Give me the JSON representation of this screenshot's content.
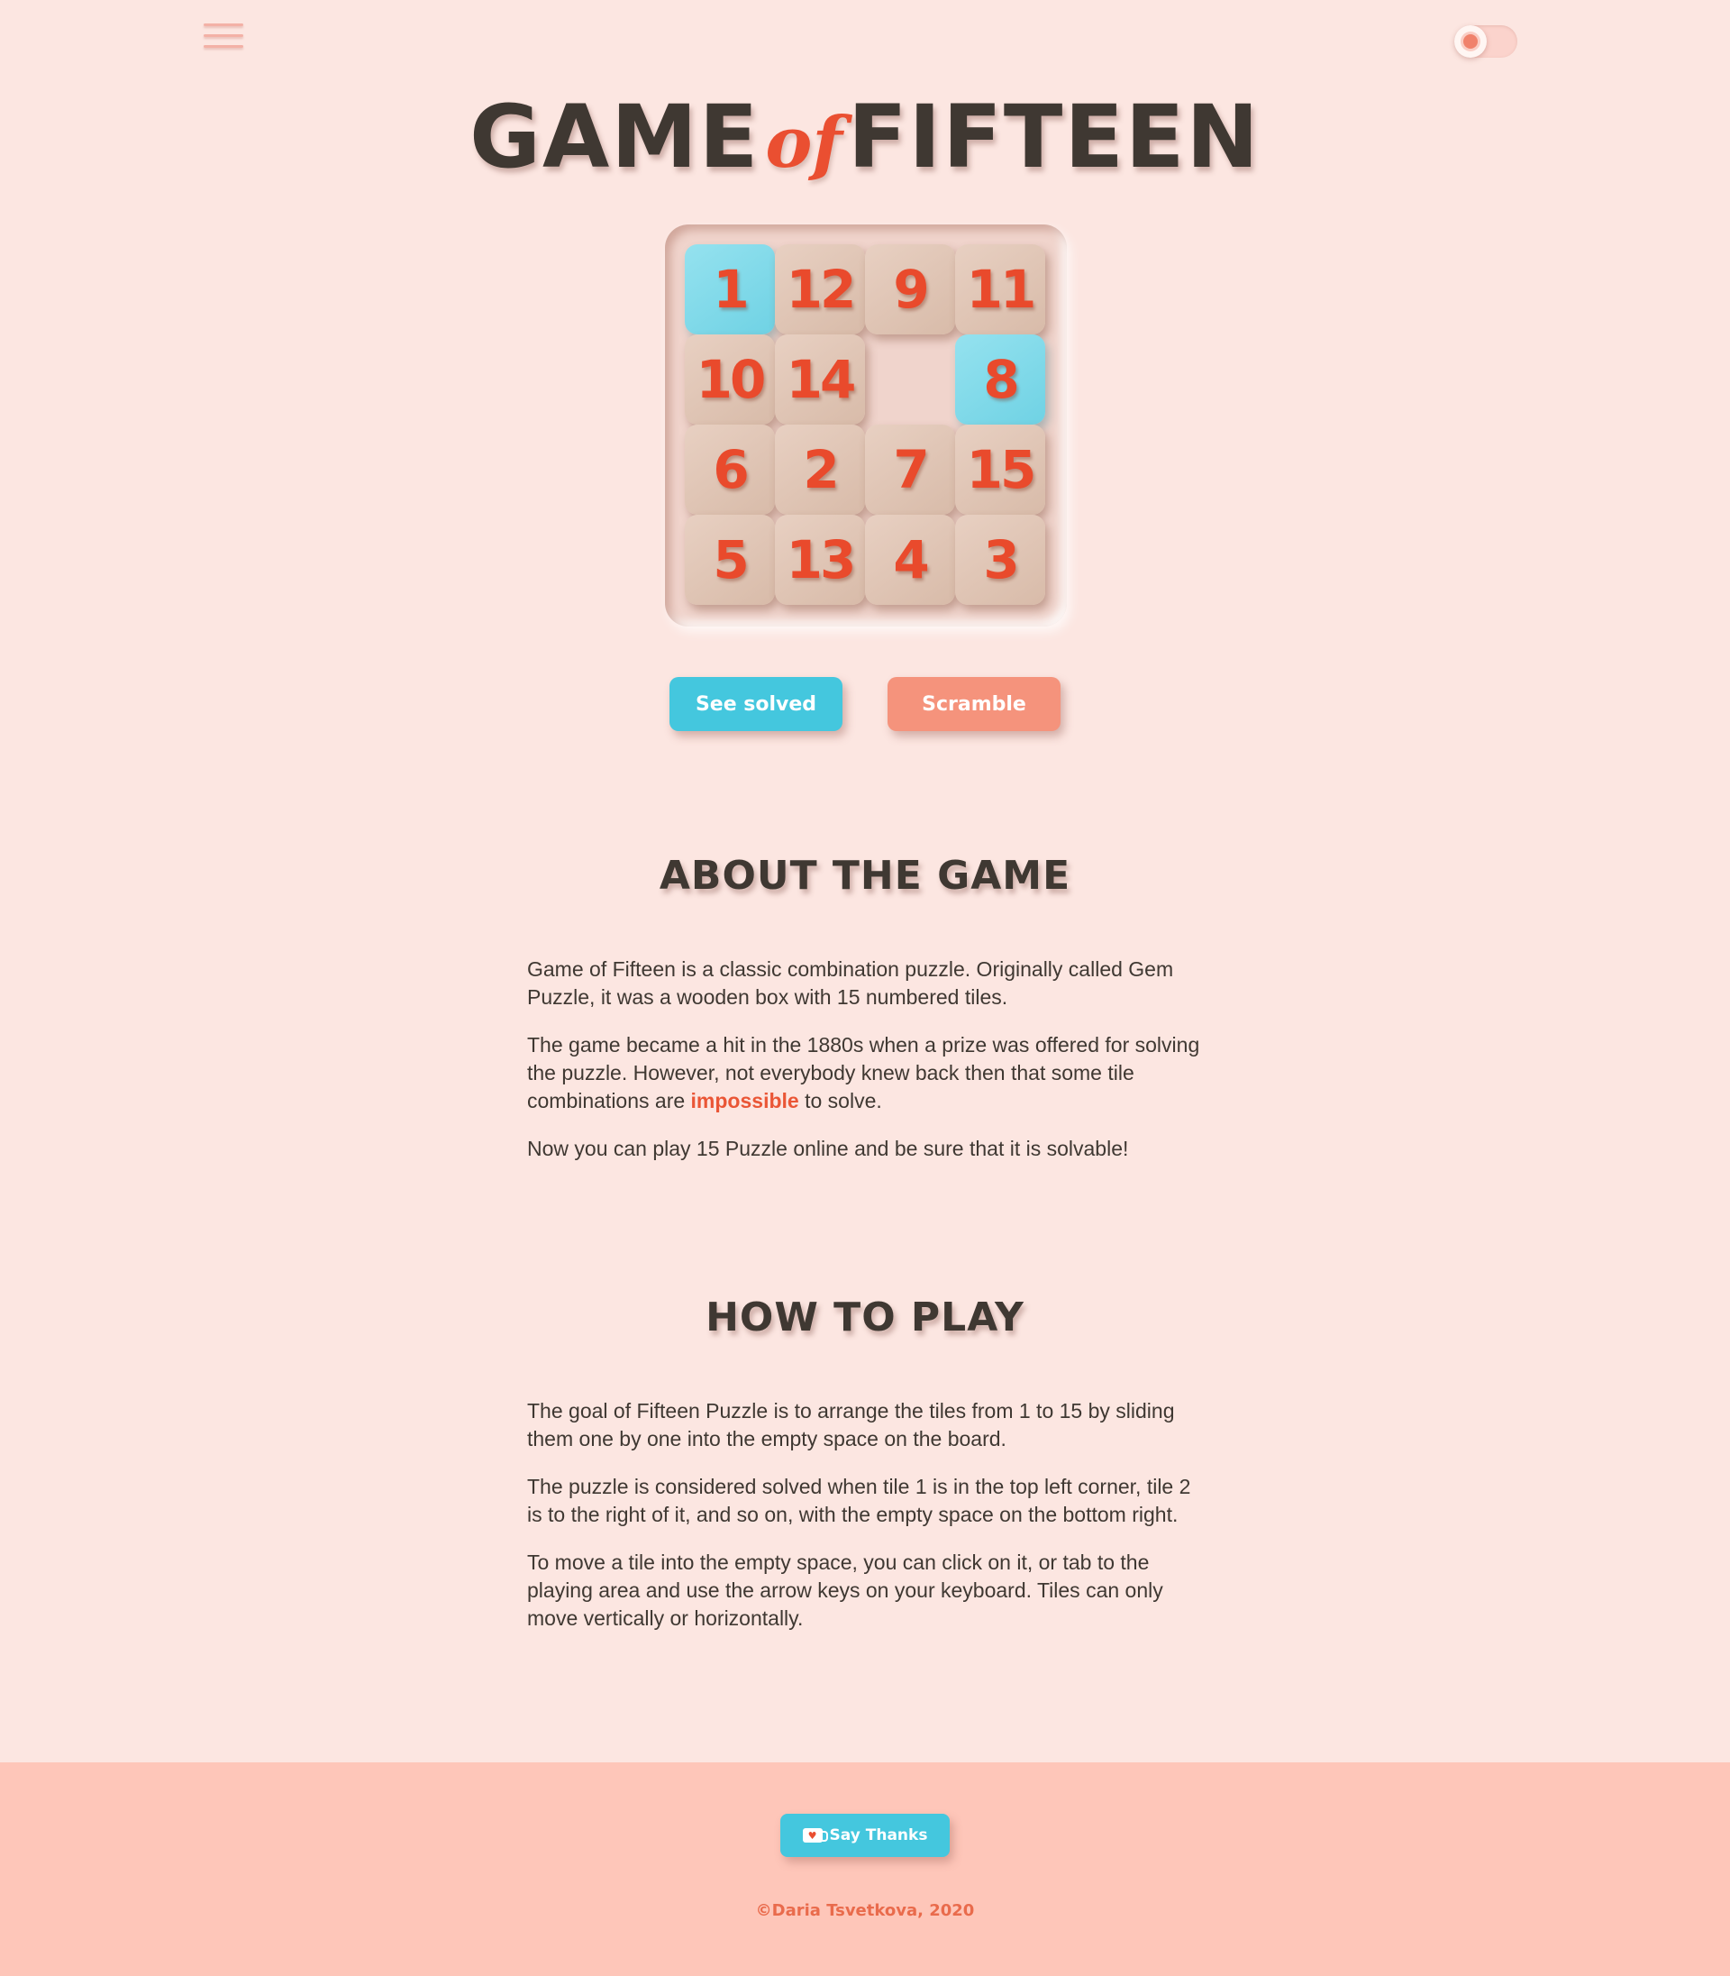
{
  "header": {
    "menu_icon": "hamburger-menu-icon",
    "theme_toggle_icon": "sun-icon"
  },
  "title": {
    "part1": "GAME",
    "part2": "of",
    "part3": "FIFTEEN"
  },
  "board": {
    "rows": 4,
    "cols": 4,
    "tiles": [
      [
        1,
        12,
        9,
        11
      ],
      [
        10,
        14,
        null,
        8
      ],
      [
        6,
        2,
        7,
        15
      ],
      [
        5,
        13,
        4,
        3
      ]
    ],
    "correct_tiles": [
      1,
      8
    ],
    "colors": {
      "correct": "#7fd8e8",
      "plain": "#dfc4b4",
      "number": "#e94a2c"
    }
  },
  "buttons": {
    "see_solved": "See solved",
    "scramble": "Scramble"
  },
  "about": {
    "heading": "ABOUT THE GAME",
    "p1": "Game of Fifteen is a classic combination puzzle. Originally called Gem Puzzle, it was a wooden box with 15 numbered tiles.",
    "p2_before": "The game became a hit in the 1880s when a prize was offered for solving the puzzle. However, not everybody knew back then that some tile combinations are ",
    "p2_highlight": "impossible",
    "p2_after": " to solve.",
    "p3": "Now you can play 15 Puzzle online and be sure that it is solvable!"
  },
  "how_to_play": {
    "heading": "HOW TO PLAY",
    "p1": "The goal of Fifteen Puzzle is to arrange the tiles from 1 to 15 by sliding them one by one into the empty space on the board.",
    "p2": "The puzzle is considered solved when tile 1 is in the top left corner, tile 2 is to the right of it, and so on, with the empty space on the bottom right.",
    "p3": "To move a tile into the empty space, you can click on it, or tab to the playing area and use the arrow keys on your keyboard. Tiles can only move vertically or horizontally."
  },
  "footer": {
    "thanks_label": "Say Thanks",
    "thanks_icon": "coffee-mug-heart-icon",
    "copyright": "©Daria Tsvetkova, 2020"
  },
  "colors": {
    "background": "#fce6e1",
    "accent_blue": "#44c7de",
    "accent_coral": "#f5937c",
    "highlight_red": "#ea5636",
    "footer_bg": "#fec6b9"
  }
}
